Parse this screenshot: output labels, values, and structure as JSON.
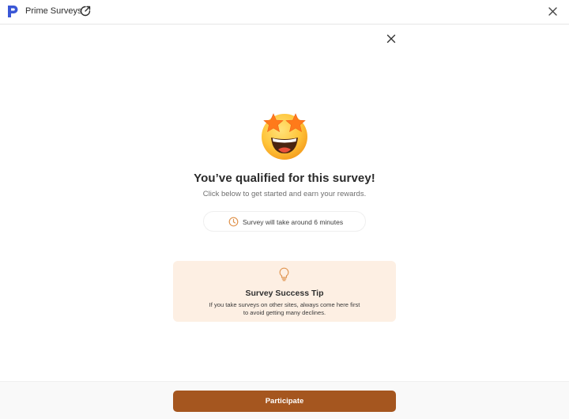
{
  "app": {
    "title": "Prime Surveys",
    "logo_icon": "p-logo-icon",
    "brand_color": "#3a57d6"
  },
  "icons": {
    "external": "external-link-icon",
    "window_close": "close-icon",
    "dialog_close": "close-icon",
    "emoji": "star-struck-emoji-icon",
    "clock": "clock-icon",
    "bulb": "lightbulb-icon"
  },
  "dialog": {
    "headline": "You’ve qualified for this survey!",
    "subline": "Click below to get started and earn your rewards.",
    "time_estimate": "Survey will take around 6 minutes"
  },
  "tip": {
    "title": "Survey Success Tip",
    "line1": "If you take surveys on other sites, always come here first",
    "line2": "to avoid getting many declines."
  },
  "footer": {
    "participate_label": "Participate",
    "button_color": "#a5561f"
  },
  "colors": {
    "accent": "#e0944f",
    "tip_background": "#fdefe3"
  }
}
